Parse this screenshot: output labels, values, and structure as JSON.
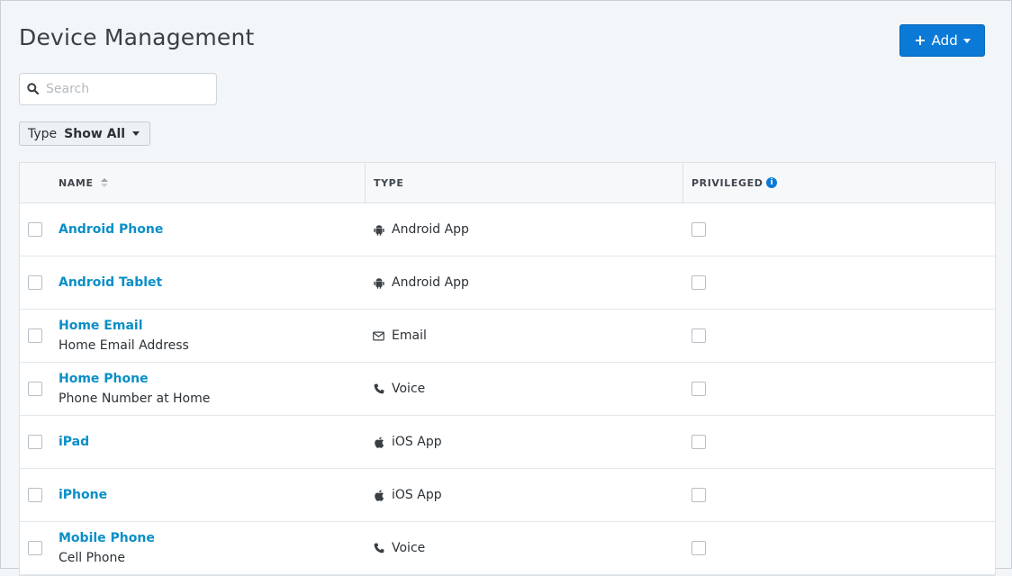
{
  "header": {
    "title": "Device Management",
    "add_label": "Add"
  },
  "search": {
    "placeholder": "Search",
    "value": ""
  },
  "filter": {
    "label": "Type",
    "value": "Show All"
  },
  "table": {
    "columns": {
      "name": "NAME",
      "type": "TYPE",
      "privileged": "PRIVILEGED"
    },
    "rows": [
      {
        "name": "Android Phone",
        "subtitle": "",
        "type": "Android App",
        "type_icon": "android-icon",
        "privileged": false
      },
      {
        "name": "Android Tablet",
        "subtitle": "",
        "type": "Android App",
        "type_icon": "android-icon",
        "privileged": false
      },
      {
        "name": "Home Email",
        "subtitle": "Home Email Address",
        "type": "Email",
        "type_icon": "envelope-icon",
        "privileged": false
      },
      {
        "name": "Home Phone",
        "subtitle": "Phone Number at Home",
        "type": "Voice",
        "type_icon": "phone-icon",
        "privileged": false
      },
      {
        "name": "iPad",
        "subtitle": "",
        "type": "iOS App",
        "type_icon": "apple-icon",
        "privileged": false
      },
      {
        "name": "iPhone",
        "subtitle": "",
        "type": "iOS App",
        "type_icon": "apple-icon",
        "privileged": false
      },
      {
        "name": "Mobile Phone",
        "subtitle": "Cell Phone",
        "type": "Voice",
        "type_icon": "phone-icon",
        "privileged": false
      }
    ]
  },
  "colors": {
    "accent": "#0a7ad6",
    "link": "#0a8fc7",
    "background": "#f3f6f9"
  }
}
